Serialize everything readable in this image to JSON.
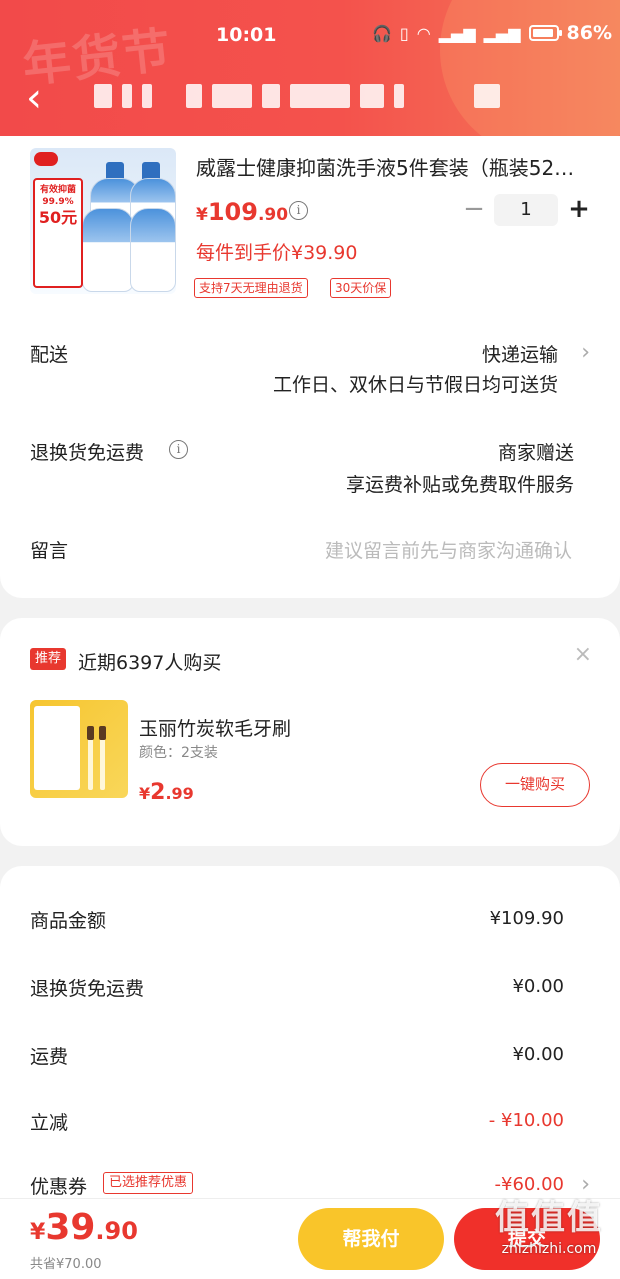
{
  "status_bar": {
    "time": "10:01",
    "battery": "86%"
  },
  "header": {
    "festival_watermark": "年货节"
  },
  "product": {
    "title": "威露士健康抑菌洗手液5件套装（瓶装52…",
    "price_yen": "¥",
    "price_int": "109",
    "price_dec": ".90",
    "quantity": "1",
    "per_item_price": "每件到手价¥39.90",
    "tags": [
      "支持7天无理由退货",
      "30天价保"
    ],
    "image_badge": {
      "line1": "有效抑菌",
      "line2": "99.9%",
      "amount": "50元"
    }
  },
  "delivery": {
    "label": "配送",
    "method": "快递运输",
    "note": "工作日、双休日与节假日均可送货"
  },
  "return_shipping": {
    "label": "退换货免运费",
    "value": "商家赠送",
    "note": "享运费补贴或免费取件服务"
  },
  "message": {
    "label": "留言",
    "placeholder": "建议留言前先与商家沟通确认"
  },
  "recommendation": {
    "tag": "推荐",
    "title": "近期6397人购买",
    "close": "×",
    "item_name": "玉丽竹炭软毛牙刷",
    "item_spec": "颜色：2支装",
    "price_yen": "¥",
    "price_int": "2",
    "price_dec": ".99",
    "buy_label": "一键购买"
  },
  "summary": {
    "rows": [
      {
        "label": "商品金额",
        "value": "¥109.90"
      },
      {
        "label": "退换货免运费",
        "value": "¥0.00"
      },
      {
        "label": "运费",
        "value": "¥0.00"
      },
      {
        "label": "立减",
        "value": "- ¥10.00"
      },
      {
        "label": "优惠券",
        "value": "-¥60.00"
      }
    ],
    "coupon_tag": "已选推荐优惠"
  },
  "bottom_bar": {
    "total_yen": "¥",
    "total_int": "39",
    "total_dec": ".90",
    "saved": "共省¥70.00",
    "help_pay_label": "帮我付",
    "pay_label": "提交"
  },
  "watermark": {
    "big": "值值值",
    "small": "zhizhizhi.com"
  },
  "colors": {
    "accent_red": "#e8382f",
    "header_red": "#f24a4a",
    "help_pay_yellow": "#f9c52a"
  }
}
